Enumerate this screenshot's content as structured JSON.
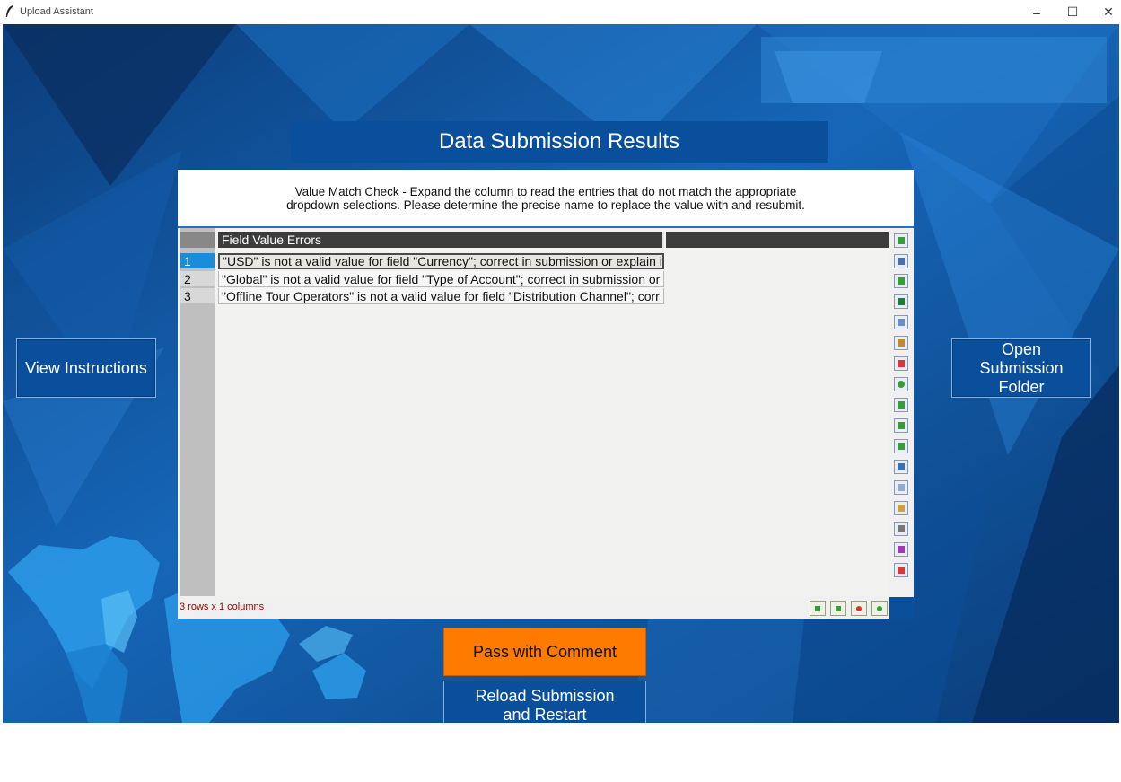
{
  "window": {
    "title": "Upload Assistant",
    "minimize_glyph": "–",
    "maximize_glyph": "☐",
    "close_glyph": "✕"
  },
  "header": {
    "title": "Data Submission Results"
  },
  "message": "Value Match Check - Expand the column to read the entries that do not match the appropriate dropdown selections. Please determine the precise name to replace the value with and resubmit.",
  "buttons": {
    "view_instructions": "View Instructions",
    "open_folder": "Open Submission Folder",
    "pass_comment": "Pass with Comment",
    "reload": "Reload Submission and Restart"
  },
  "table": {
    "column_header": "Field Value Errors",
    "rows": [
      {
        "num": "1",
        "value": "\"USD\" is not a valid value for field \"Currency\"; correct in submission or explain i"
      },
      {
        "num": "2",
        "value": "\"Global\" is not a valid value for field \"Type of Account\"; correct in submission or"
      },
      {
        "num": "3",
        "value": "\"Offline Tour Operators\" is not a valid value for field \"Distribution Channel\"; corr"
      }
    ],
    "status": "3 rows x 1 columns",
    "toolbar_icons": [
      "import-icon",
      "save-icon",
      "export-icon",
      "excel-icon",
      "copy-icon",
      "paste-icon",
      "plot-icon",
      "transform-icon",
      "merge-icon",
      "pivot-icon",
      "melt-icon",
      "chart-icon",
      "duplicate-icon",
      "report-icon",
      "calculator-icon",
      "image-icon",
      "delete-icon"
    ],
    "status_icons": [
      "expand-columns-icon",
      "expand-rows-icon",
      "red-dot-icon",
      "green-dot-icon"
    ]
  },
  "colors": {
    "button_blue": "#0a4f9c",
    "pass_orange": "#ff7b00",
    "selected_row": "#1a8dd6",
    "status_text": "#a00000"
  }
}
